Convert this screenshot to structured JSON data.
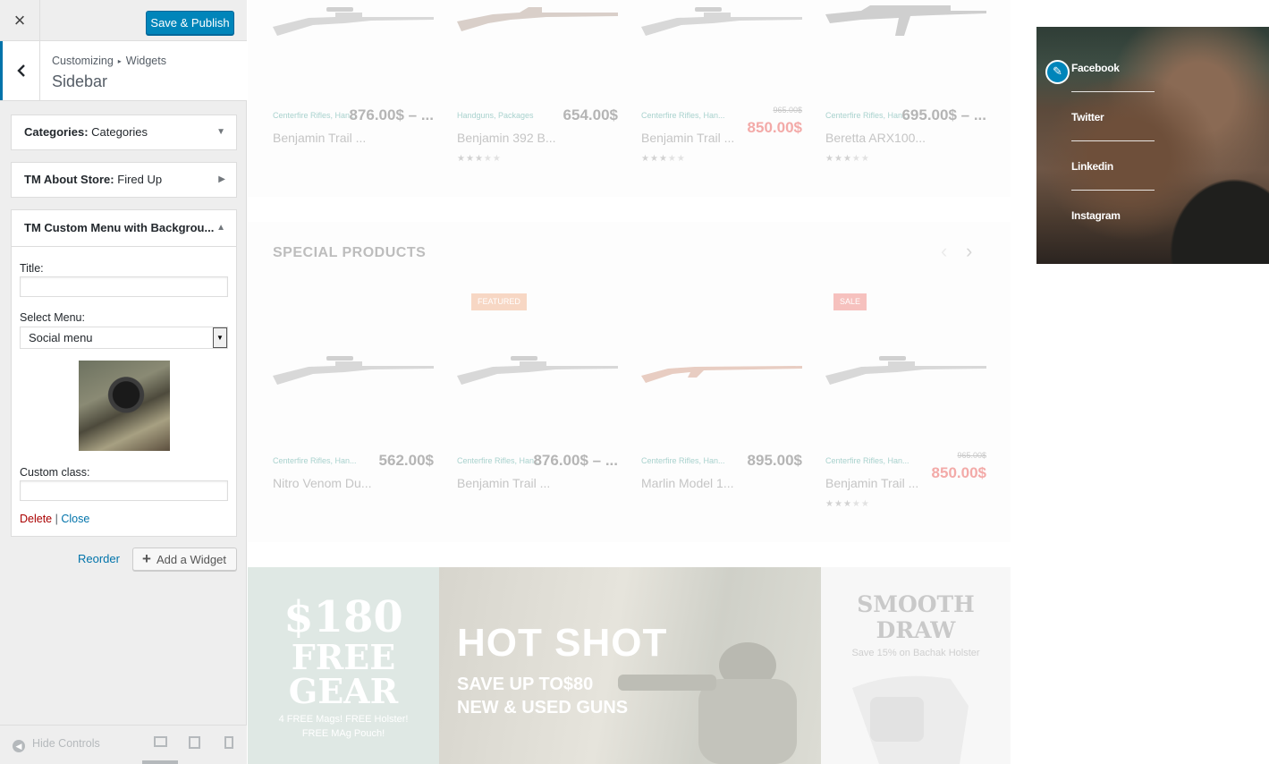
{
  "customizer": {
    "close_label": "×",
    "publish_label": "Save & Publish",
    "breadcrumb": {
      "root": "Customizing",
      "separator": "▸",
      "current": "Widgets"
    },
    "section_title": "Sidebar",
    "widgets": [
      {
        "type": "Categories:",
        "title": "Categories",
        "state": "collapsed"
      },
      {
        "type": "TM About Store:",
        "title": "Fired Up",
        "state": "collapsed"
      },
      {
        "type": "TM Custom Menu with Backgrou...",
        "title": "",
        "state": "expanded"
      }
    ],
    "form": {
      "title_label": "Title:",
      "title_value": "",
      "select_label": "Select Menu:",
      "select_value": "Social menu",
      "class_label": "Custom class:",
      "class_value": "",
      "delete_label": "Delete",
      "link_sep": "|",
      "close_label": "Close"
    },
    "reorder_label": "Reorder",
    "add_widget_label": "Add a Widget",
    "hide_controls_label": "Hide Controls"
  },
  "preview": {
    "top_products": [
      {
        "category": "Centerfire Rifles, Han...",
        "price": "876.00$ – ...",
        "old_price": "",
        "name": "Benjamin Trail ...",
        "stars": 0,
        "gun": "rifle"
      },
      {
        "category": "Handguns, Packages",
        "price": "654.00$",
        "old_price": "",
        "name": "Benjamin 392 B...",
        "stars": 3,
        "gun": "rifle2"
      },
      {
        "category": "Centerfire Rifles, Han...",
        "price": "850.00$",
        "old_price": "965.00$",
        "name": "Benjamin Trail ...",
        "stars": 3,
        "gun": "rifle"
      },
      {
        "category": "Centerfire Rifles, Han...",
        "price": "695.00$ – ...",
        "old_price": "",
        "name": "Beretta ARX100...",
        "stars": 3.5,
        "gun": "assault"
      }
    ],
    "special_title": "SPECIAL PRODUCTS",
    "special_products": [
      {
        "tag": "",
        "category": "Centerfire Rifles, Han...",
        "price": "562.00$",
        "old_price": "",
        "name": "Nitro Venom Du...",
        "stars": 0,
        "gun": "rifle"
      },
      {
        "tag": "FEATURED",
        "category": "Centerfire Rifles, Han...",
        "price": "876.00$ – ...",
        "old_price": "",
        "name": "Benjamin Trail ...",
        "stars": 0,
        "gun": "rifle"
      },
      {
        "tag": "",
        "category": "Centerfire Rifles, Han...",
        "price": "895.00$",
        "old_price": "",
        "name": "Marlin Model 1...",
        "stars": 0,
        "gun": "lever"
      },
      {
        "tag": "SALE",
        "category": "Centerfire Rifles, Han...",
        "price": "850.00$",
        "old_price": "965.00$",
        "name": "Benjamin Trail ...",
        "stars": 3,
        "gun": "rifle"
      }
    ],
    "banners": {
      "b1": {
        "line1": "$180",
        "line2": "FREE",
        "line3": "GEAR",
        "small1": "4 FREE Mags! FREE Holster!",
        "small2": "FREE MAg Pouch!"
      },
      "b2": {
        "title": "HOT SHOT",
        "sub1": "SAVE UP TO$80",
        "sub2": "NEW & USED GUNS"
      },
      "b3": {
        "title1": "SMOOTH",
        "title2": "DRAW",
        "sub": "Save 15% on Bachak Holster"
      }
    },
    "social_menu": [
      "Facebook",
      "Twitter",
      "Linkedin",
      "Instagram"
    ]
  },
  "colors": {
    "accent": "#0085ba",
    "sale_price": "#f3aaa8",
    "featured_tag": "#f7d7c4",
    "sale_tag": "#f6c1be",
    "delete_link": "#aa0000"
  }
}
